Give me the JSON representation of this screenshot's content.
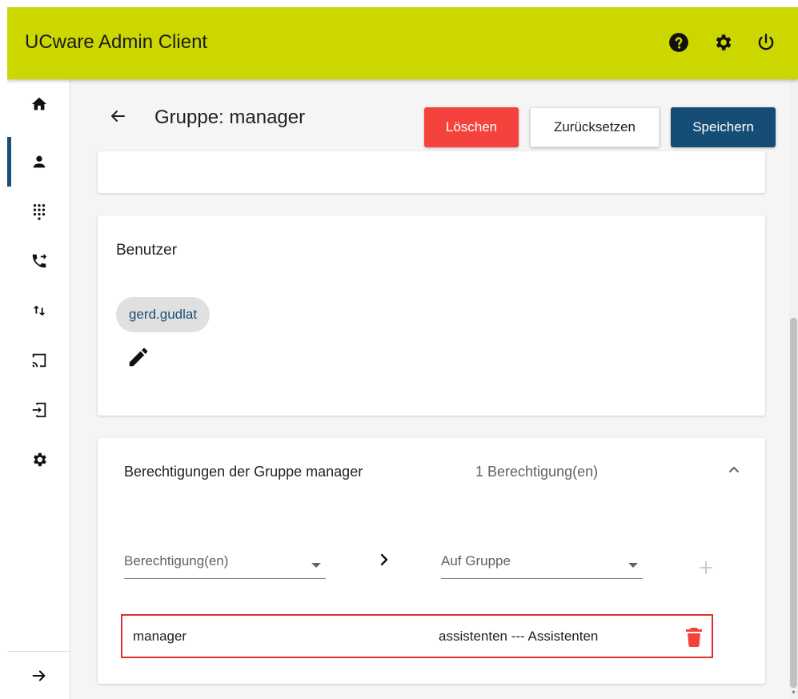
{
  "app": {
    "title": "UCware Admin Client",
    "accent_color": "#ccd700",
    "primary_color": "#154d75",
    "danger_color": "#f4433c"
  },
  "topbar_icons": [
    "help-icon",
    "settings-icon",
    "power-icon"
  ],
  "sidebar": {
    "items": [
      {
        "icon": "home-icon",
        "active": false
      },
      {
        "icon": "user-icon",
        "active": true
      },
      {
        "icon": "dialpad-icon",
        "active": false
      },
      {
        "icon": "phone-forward-icon",
        "active": false
      },
      {
        "icon": "swap-vert-icon",
        "active": false
      },
      {
        "icon": "cast-icon",
        "active": false
      },
      {
        "icon": "login-icon",
        "active": false
      },
      {
        "icon": "settings-icon",
        "active": false
      }
    ],
    "bottom_icon": "arrow-right-icon"
  },
  "header": {
    "title": "Gruppe: manager",
    "delete_label": "Löschen",
    "reset_label": "Zurücksetzen",
    "save_label": "Speichern"
  },
  "users_card": {
    "title": "Benutzer",
    "chips": [
      "gerd.gudlat"
    ]
  },
  "permissions_card": {
    "title": "Berechtigungen der Gruppe manager",
    "count": "1 Berechtigung(en)",
    "permission_select_placeholder": "Berechtigung(en)",
    "group_select_placeholder": "Auf Gruppe",
    "rows": [
      {
        "permission": "manager",
        "target": "assistenten --- Assistenten"
      }
    ]
  }
}
